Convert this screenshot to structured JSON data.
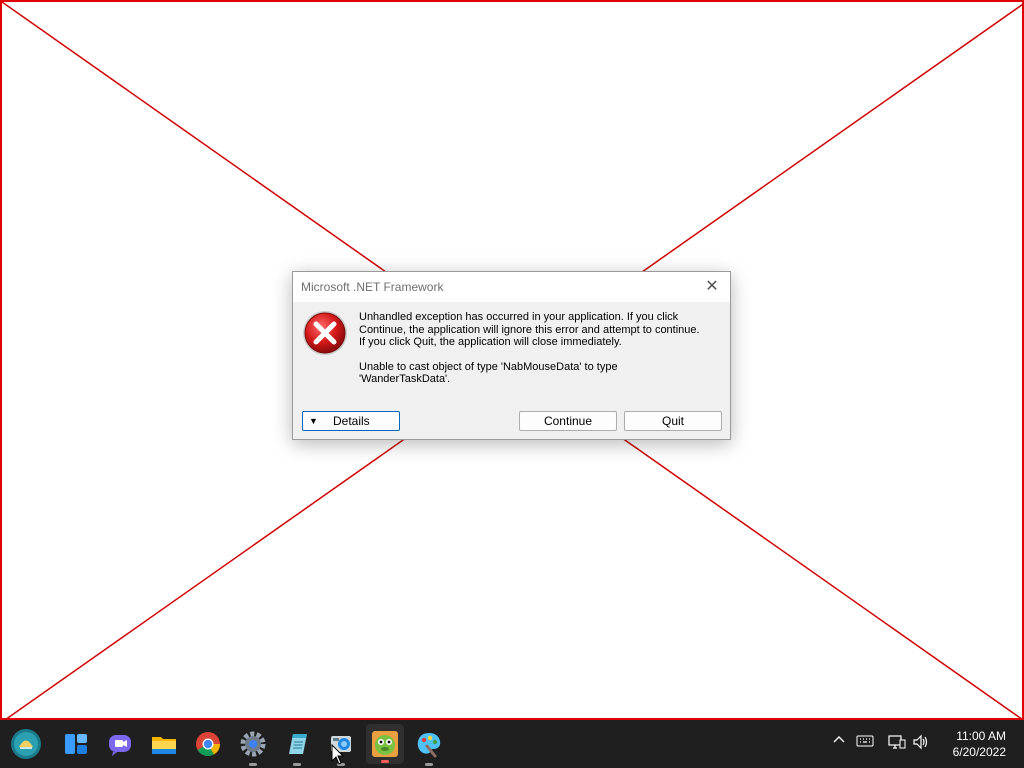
{
  "dialog": {
    "title": "Microsoft .NET Framework",
    "message_line1": "Unhandled exception has occurred in your application. If you click",
    "message_line2": "Continue, the application will ignore this error and attempt to continue.",
    "message_line3": "If you click Quit, the application will close immediately.",
    "error_line1": "Unable to cast object of type 'NabMouseData' to type",
    "error_line2": "'WanderTaskData'.",
    "details_label": "Details",
    "continue_label": "Continue",
    "quit_label": "Quit",
    "close_glyph": "✕"
  },
  "taskbar": {
    "apps": [
      {
        "name": "start-icon"
      },
      {
        "name": "widgets-icon"
      },
      {
        "name": "chat-icon"
      },
      {
        "name": "file-explorer-icon"
      },
      {
        "name": "chrome-icon"
      },
      {
        "name": "settings-icon"
      },
      {
        "name": "notepad-icon"
      },
      {
        "name": "photos-icon"
      },
      {
        "name": "game-app-icon"
      },
      {
        "name": "paint-icon"
      }
    ],
    "clock_time": "11:00 AM",
    "clock_date": "6/20/2022"
  },
  "colors": {
    "placeholder_border": "#e00000",
    "taskbar": "#1f1f1f",
    "error_red": "#d31818"
  }
}
